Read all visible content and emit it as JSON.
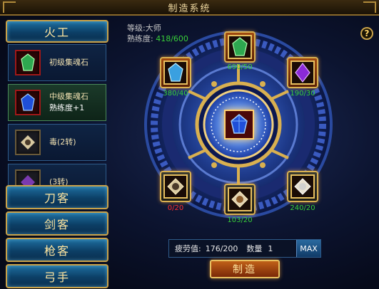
{
  "window": {
    "title": "制造系统"
  },
  "categories": {
    "active": "火工",
    "others": [
      "刀客",
      "剑客",
      "枪客",
      "弓手"
    ]
  },
  "recipes": [
    {
      "name": "初级集魂石",
      "sub": "",
      "gem": "green",
      "selected": false
    },
    {
      "name": "中级集魂石",
      "sub": "熟练度+1",
      "gem": "blue",
      "selected": true
    },
    {
      "name": "毒(2转)",
      "sub": "",
      "gem": "tan",
      "selected": false
    },
    {
      "name": "(3转)",
      "sub": "",
      "gem": "purple",
      "selected": false
    }
  ],
  "info": {
    "level_label": "等级:",
    "level_value": "大师",
    "proficiency_label": "熟练度:",
    "proficiency_value": "418/600"
  },
  "help_label": "?",
  "materials": [
    {
      "id": "top",
      "gem": "green",
      "count": "690/50"
    },
    {
      "id": "left-top",
      "gem": "cyan",
      "count": "380/40"
    },
    {
      "id": "right-top",
      "gem": "purple",
      "count": "190/30"
    },
    {
      "id": "left-bottom",
      "gem": "tan",
      "count": "0/20"
    },
    {
      "id": "bottom",
      "gem": "brown",
      "count": "103/20"
    },
    {
      "id": "right-bottom",
      "gem": "white",
      "count": "240/20"
    }
  ],
  "fatigue": {
    "label": "疲劳值:",
    "value": "176/200"
  },
  "quantity": {
    "label": "数量",
    "value": "1"
  },
  "max_label": "MAX",
  "make_label": "制造",
  "colors": {
    "accent": "#c9a24a",
    "green": "#39d039",
    "red": "#ff3030"
  }
}
